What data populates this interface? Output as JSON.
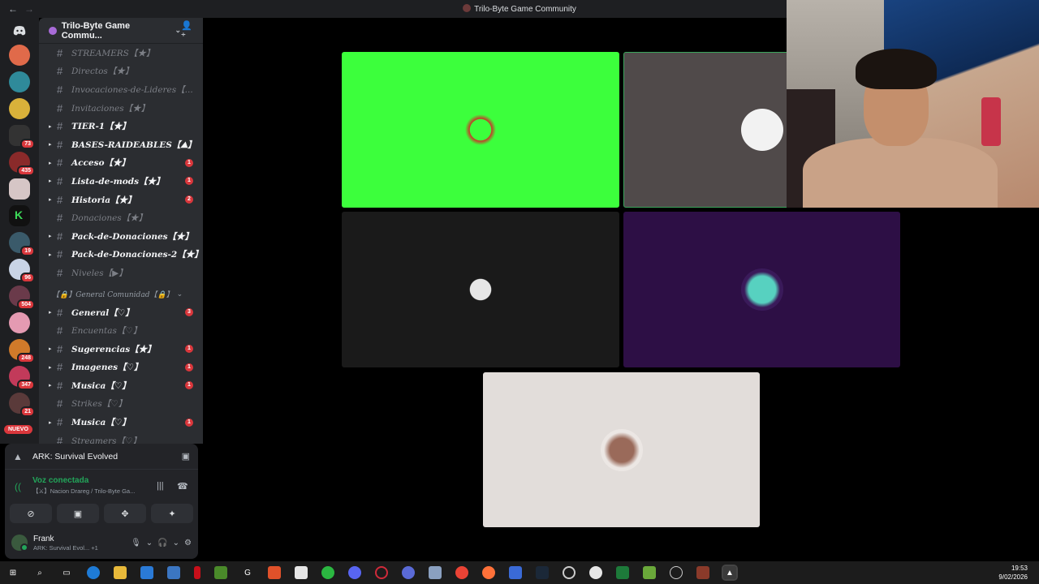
{
  "window": {
    "title": "Trilo-Byte Game Community"
  },
  "guild": {
    "name": "Trilo-Byte Game Commu..."
  },
  "rail": {
    "badges": [
      "73",
      "435",
      "19",
      "96",
      "504",
      "248",
      "347",
      "21"
    ],
    "new_label": "NUEVO"
  },
  "channels": [
    {
      "label": "STREAMERS【★】",
      "state": "muted",
      "arrow": false,
      "mention": ""
    },
    {
      "label": "Directos【★】",
      "state": "muted",
      "arrow": false,
      "mention": ""
    },
    {
      "label": "Invocaciones-de-Lideres【...",
      "state": "muted",
      "arrow": false,
      "mention": ""
    },
    {
      "label": "Invitaciones【★】",
      "state": "muted",
      "arrow": false,
      "mention": ""
    },
    {
      "label": "TIER-1【★】",
      "state": "unread",
      "arrow": true,
      "mention": ""
    },
    {
      "label": "BASES-RAIDEABLES【⛰】",
      "state": "unread",
      "arrow": true,
      "mention": ""
    },
    {
      "label": "Acceso【★】",
      "state": "unread",
      "arrow": true,
      "mention": "1"
    },
    {
      "label": "Lista-de-mods【★】",
      "state": "unread",
      "arrow": true,
      "mention": "1"
    },
    {
      "label": "Historia【★】",
      "state": "unread",
      "arrow": true,
      "mention": "2"
    },
    {
      "label": "Donaciones【★】",
      "state": "muted",
      "arrow": false,
      "mention": ""
    },
    {
      "label": "Pack-de-Donaciones【★】",
      "state": "unread",
      "arrow": true,
      "mention": ""
    },
    {
      "label": "Pack-de-Donaciones-2【★】",
      "state": "unread",
      "arrow": true,
      "mention": ""
    },
    {
      "label": "Niveles【▶】",
      "state": "muted",
      "arrow": false,
      "mention": ""
    }
  ],
  "category": {
    "label": "【🔒】General Comunidad【🔒】"
  },
  "channels2": [
    {
      "label": "General【♡】",
      "state": "unread",
      "arrow": true,
      "mention": "3"
    },
    {
      "label": "Encuentas【♡】",
      "state": "muted",
      "arrow": false,
      "mention": ""
    },
    {
      "label": "Sugerencias【★】",
      "state": "unread",
      "arrow": true,
      "mention": "1"
    },
    {
      "label": "Imagenes【♡】",
      "state": "unread",
      "arrow": true,
      "mention": "1"
    },
    {
      "label": "Musica【♡】",
      "state": "unread",
      "arrow": true,
      "mention": "1"
    },
    {
      "label": "Strikes【♡】",
      "state": "muted",
      "arrow": false,
      "mention": ""
    },
    {
      "label": "Musica【♡】",
      "state": "unread",
      "arrow": true,
      "mention": "1"
    },
    {
      "label": "Streamers【♡】",
      "state": "muted",
      "arrow": false,
      "mention": ""
    }
  ],
  "activity": {
    "game": "ARK: Survival Evolved"
  },
  "voice": {
    "status": "Voz conectada",
    "location": "【⚔】Nacion Drareg / Trilo-Byte Ga..."
  },
  "user": {
    "name": "Frank",
    "status": "ARK: Survival Evol...",
    "extra": "+1"
  },
  "colors": {
    "tile_green": "#3cff3c",
    "tile_gray": "#504a4a",
    "tile_dark": "#1a1a1a",
    "tile_purple": "#2d0f45",
    "tile_light": "#e2ddda"
  },
  "clock": {
    "time": "19:53",
    "date": "9/02/2026"
  }
}
